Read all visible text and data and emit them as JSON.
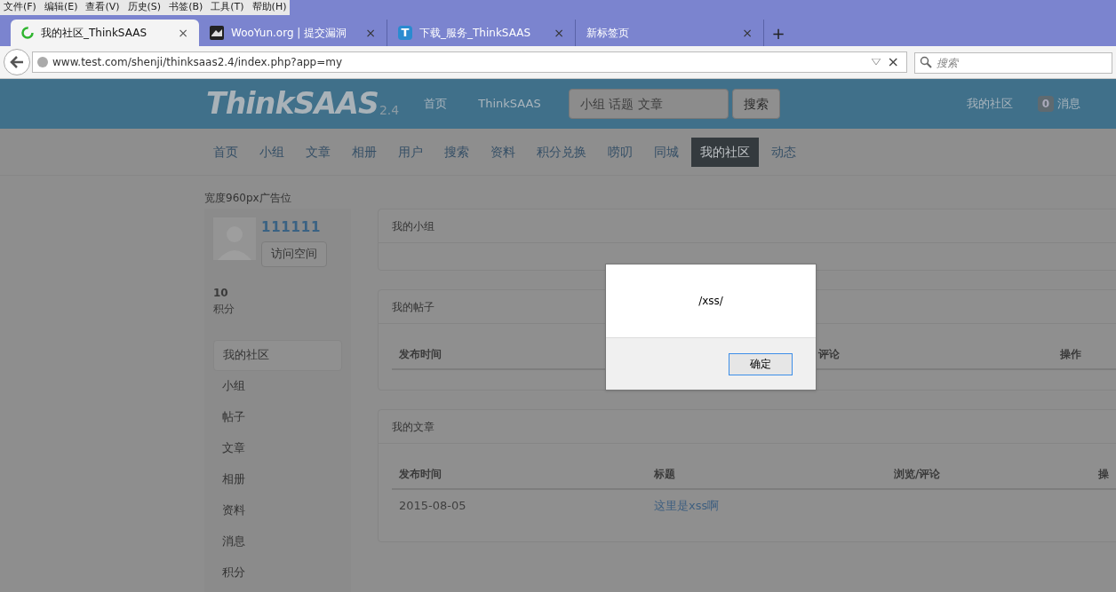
{
  "browser": {
    "menu": [
      "文件(F)",
      "编辑(E)",
      "查看(V)",
      "历史(S)",
      "书签(B)",
      "工具(T)",
      "帮助(H)"
    ],
    "tabs": [
      {
        "title": "我的社区_ThinkSAAS",
        "selected": true,
        "kind": "loading",
        "close": "×"
      },
      {
        "title": "WooYun.org | 提交漏洞",
        "selected": false,
        "kind": "image",
        "close": "×"
      },
      {
        "title": "下载_服务_ThinkSAAS",
        "selected": false,
        "kind": "letter",
        "icon_text": "T",
        "close": "×"
      },
      {
        "title": "新标签页",
        "selected": false,
        "kind": "none",
        "close": "×"
      }
    ],
    "new_tab": "+",
    "url": "www.test.com/shenji/thinksaas2.4/index.php?app=my",
    "clear": "×",
    "search": {
      "placeholder": "搜索"
    }
  },
  "header": {
    "logo": "ThinkSAAS",
    "version": "2.4",
    "links": [
      "首页",
      "ThinkSAAS"
    ],
    "search": {
      "placeholder": "小组 话题 文章"
    },
    "search_button": "搜索",
    "user_link": "我的社区",
    "message_count": "0",
    "message_label": "消息"
  },
  "nav": [
    {
      "label": "首页",
      "selected": false
    },
    {
      "label": "小组",
      "selected": false
    },
    {
      "label": "文章",
      "selected": false
    },
    {
      "label": "相册",
      "selected": false
    },
    {
      "label": "用户",
      "selected": false
    },
    {
      "label": "搜索",
      "selected": false
    },
    {
      "label": "资料",
      "selected": false
    },
    {
      "label": "积分兑换",
      "selected": false
    },
    {
      "label": "唠叨",
      "selected": false
    },
    {
      "label": "同城",
      "selected": false
    },
    {
      "label": "我的社区",
      "selected": true
    },
    {
      "label": "动态",
      "selected": false
    }
  ],
  "ad": "宽度960px广告位",
  "profile": {
    "name": "111111",
    "visit_button": "访问空间",
    "points": "10",
    "points_label": "积分"
  },
  "side_menu": [
    {
      "label": "我的社区",
      "selected": true
    },
    {
      "label": "小组",
      "selected": false
    },
    {
      "label": "帖子",
      "selected": false
    },
    {
      "label": "文章",
      "selected": false
    },
    {
      "label": "相册",
      "selected": false
    },
    {
      "label": "资料",
      "selected": false
    },
    {
      "label": "消息",
      "selected": false
    },
    {
      "label": "积分",
      "selected": false
    }
  ],
  "panels": [
    {
      "title": "我的小组"
    },
    {
      "title": "我的帖子",
      "columns": [
        "发布时间",
        "评论",
        "操作"
      ]
    },
    {
      "title": "我的文章",
      "columns": [
        "发布时间",
        "标题",
        "浏览/评论",
        "操"
      ],
      "rows": [
        {
          "date": "2015-08-05",
          "title": "这里是xss啊"
        }
      ]
    }
  ],
  "dialog": {
    "message": "/xss/",
    "button": "确定"
  }
}
